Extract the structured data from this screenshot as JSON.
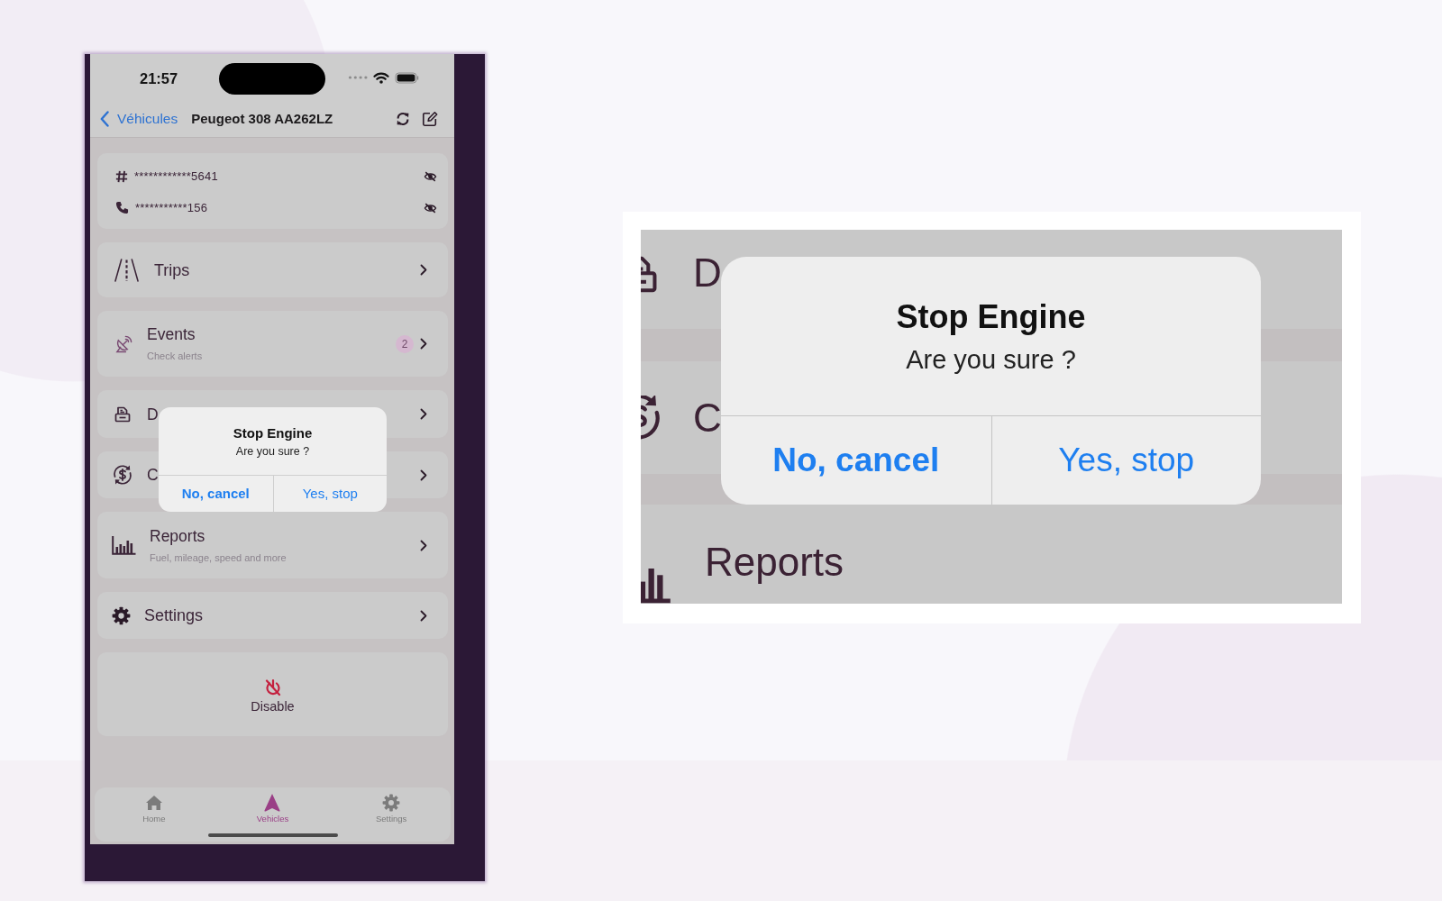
{
  "phone": {
    "status_bar": {
      "time": "21:57"
    },
    "nav_bar": {
      "back_label": "Véhicules",
      "title": "Peugeot 308 AA262LZ"
    },
    "identifiers": [
      {
        "value": "************5641"
      },
      {
        "value": "***********156"
      }
    ],
    "menu": [
      {
        "label": "Trips"
      },
      {
        "label": "Events",
        "subtitle": "Check alerts",
        "badge": "2"
      },
      {
        "label": "D"
      },
      {
        "label": "C"
      },
      {
        "label": "Reports",
        "subtitle": "Fuel, mileage, speed and more"
      },
      {
        "label": "Settings"
      }
    ],
    "disable_button": {
      "label": "Disable"
    },
    "tab_bar": [
      {
        "label": "Home",
        "selected": false
      },
      {
        "label": "Vehicles",
        "selected": true
      },
      {
        "label": "Settings",
        "selected": false
      }
    ],
    "alert": {
      "title": "Stop Engine",
      "message": "Are you sure ?",
      "buttons": [
        {
          "label": "No, cancel",
          "kind": "cancel"
        },
        {
          "label": "Yes, stop",
          "kind": "default"
        }
      ]
    }
  },
  "magnified_view": {
    "rows": [
      {
        "label": "D"
      },
      {
        "label": "C"
      },
      {
        "label": "Reports"
      }
    ],
    "alert": {
      "title": "Stop Engine",
      "message": "Are you sure ?",
      "buttons": [
        {
          "label": "No, cancel",
          "kind": "cancel"
        },
        {
          "label": "Yes, stop",
          "kind": "default"
        }
      ]
    }
  }
}
